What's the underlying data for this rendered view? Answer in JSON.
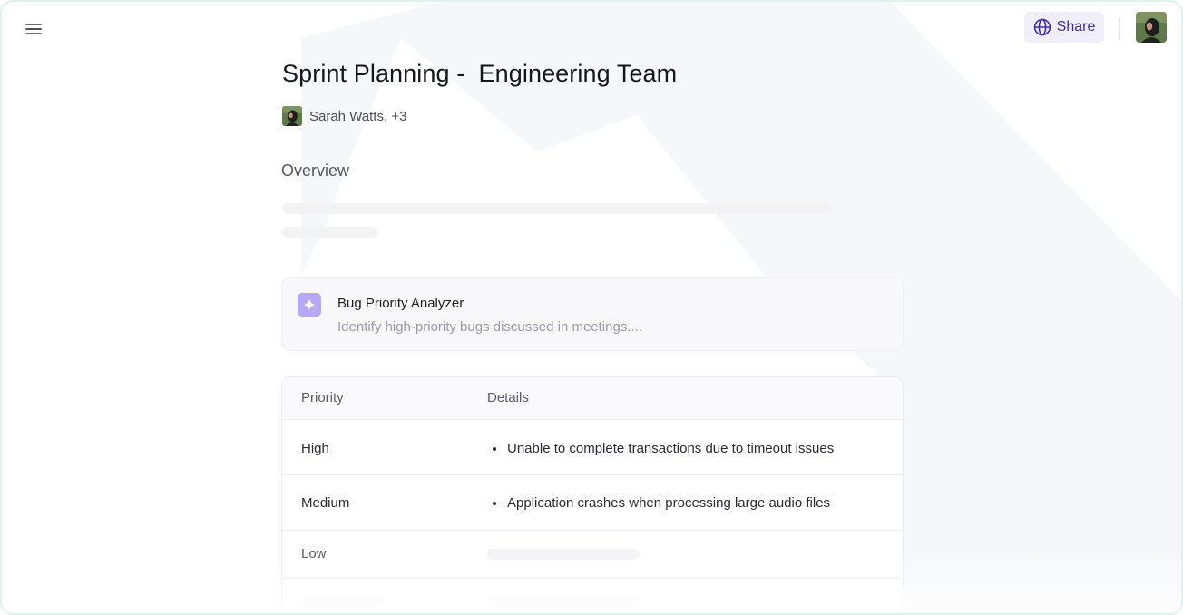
{
  "header": {
    "menu_icon": "hamburger-menu-icon",
    "share_label": "Share",
    "share_icon": "globe-icon",
    "accent_color": "#3d2bb8"
  },
  "document": {
    "title": "Sprint Planning -  Engineering Team",
    "author_text": "Sarah Watts, +3",
    "section_heading": "Overview"
  },
  "analyzer": {
    "icon": "sparkle-icon",
    "title": "Bug Priority Analyzer",
    "subtitle": "Identify high-priority bugs discussed in meetings...."
  },
  "table": {
    "headers": [
      "Priority",
      "Details"
    ],
    "rows": [
      {
        "priority": "High",
        "detail": "Unable to complete transactions due to timeout issues"
      },
      {
        "priority": "Medium",
        "detail": "Application crashes when processing large audio files"
      },
      {
        "priority": "Low",
        "detail": ""
      }
    ]
  }
}
